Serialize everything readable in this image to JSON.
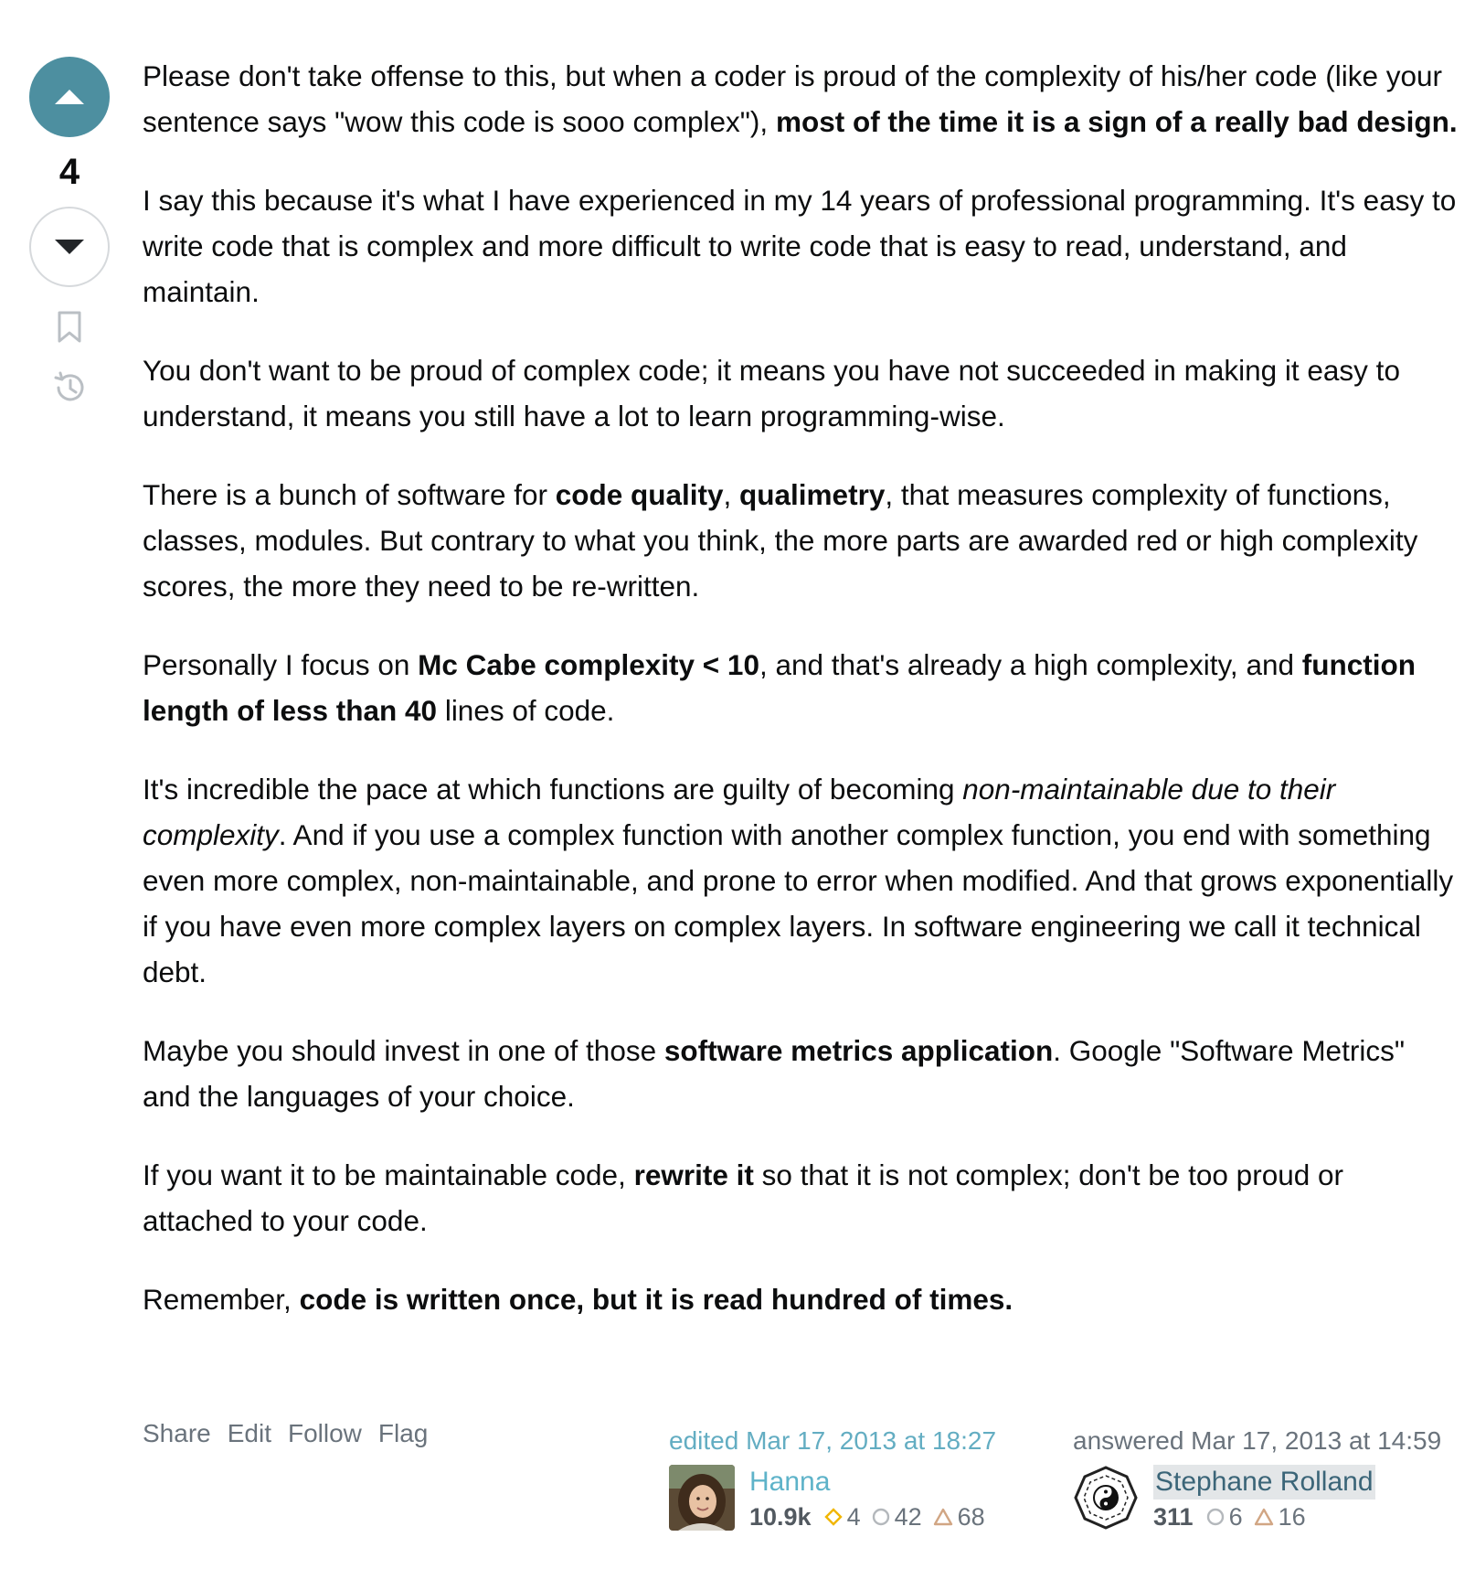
{
  "vote": {
    "count": "4"
  },
  "post": {
    "paragraphs": [
      [
        {
          "t": "Please don't take offense to this, but when a coder is proud of the complexity of his/her code (like your sentence says \"wow this code is sooo complex\"), "
        },
        {
          "t": "most of the time it is a sign of a really bad design.",
          "b": true
        }
      ],
      [
        {
          "t": "I say this because it's what I have experienced in my 14 years of professional programming. It's easy to write code that is complex and more difficult to write code that is easy to read, understand, and maintain."
        }
      ],
      [
        {
          "t": "You don't want to be proud of complex code; it means you have not succeeded in making it easy to understand, it means you still have a lot to learn programming-wise."
        }
      ],
      [
        {
          "t": "There is a bunch of software for "
        },
        {
          "t": "code quality",
          "b": true
        },
        {
          "t": ", "
        },
        {
          "t": "qualimetry",
          "b": true
        },
        {
          "t": ", that measures complexity of functions, classes, modules. But contrary to what you think, the more parts are awarded red or high complexity scores, the more they need to be re-written."
        }
      ],
      [
        {
          "t": "Personally I focus on "
        },
        {
          "t": "Mc Cabe complexity < 10",
          "b": true
        },
        {
          "t": ", and that's already a high complexity, and "
        },
        {
          "t": "function length of less than 40",
          "b": true
        },
        {
          "t": " lines of code."
        }
      ],
      [
        {
          "t": "It's incredible the pace at which functions are guilty of becoming "
        },
        {
          "t": "non-maintainable due to their complexity",
          "i": true
        },
        {
          "t": ". And if you use a complex function with another complex function, you end with something even more complex, non-maintainable, and prone to error when modified. And that grows exponentially if you have even more complex layers on complex layers. In software engineering we call it technical debt."
        }
      ],
      [
        {
          "t": "Maybe you should invest in one of those "
        },
        {
          "t": "software metrics application",
          "b": true
        },
        {
          "t": ". Google \"Software Metrics\" and the languages of your choice."
        }
      ],
      [
        {
          "t": "If you want it to be maintainable code, "
        },
        {
          "t": "rewrite it",
          "b": true
        },
        {
          "t": " so that it is not complex; don't be too proud or attached to your code."
        }
      ],
      [
        {
          "t": "Remember, "
        },
        {
          "t": "code is written once, but it is read hundred of times.",
          "b": true
        }
      ]
    ]
  },
  "menu": {
    "share": "Share",
    "edit": "Edit",
    "follow": "Follow",
    "flag": "Flag"
  },
  "editor": {
    "action": "edited Mar 17, 2013 at 18:27",
    "name": "Hanna",
    "reputation": "10.9k",
    "gold": "4",
    "silver": "42",
    "bronze": "68"
  },
  "author": {
    "action": "answered Mar 17, 2013 at 14:59",
    "name": "Stephane Rolland",
    "reputation": "311",
    "silver": "6",
    "bronze": "16"
  },
  "colors": {
    "upvote_active": "#4d8fa0",
    "gold_badge": "#f1b600",
    "silver_badge": "#b4b8bc",
    "bronze_badge": "#d1a684"
  }
}
